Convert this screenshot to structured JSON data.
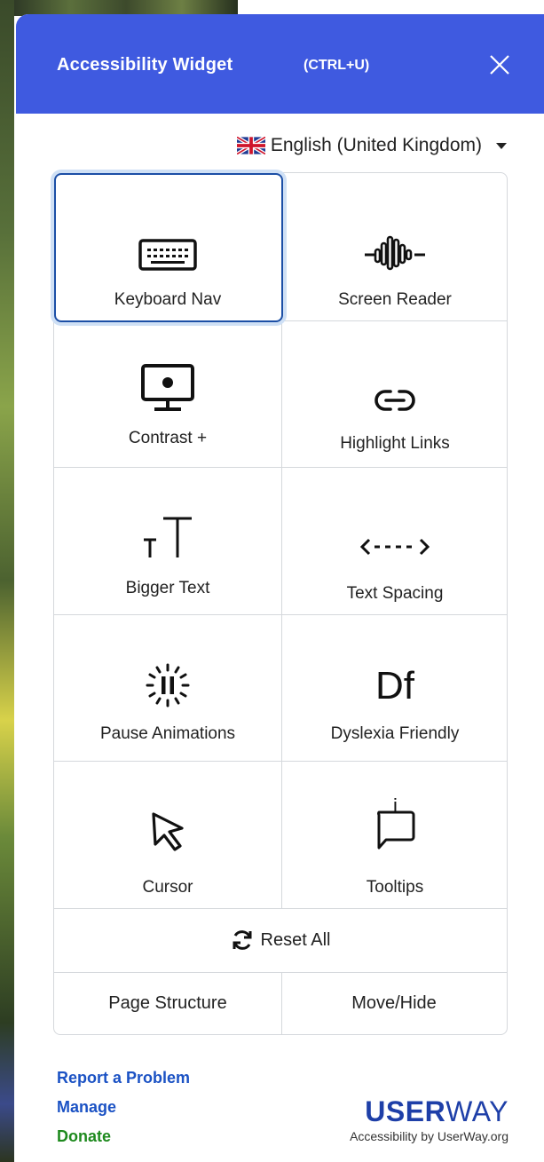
{
  "header": {
    "title": "Accessibility Widget",
    "shortcut": "(CTRL+U)",
    "close_icon": "close-icon"
  },
  "language": {
    "flag_icon": "uk-flag-icon",
    "selected": "English (United Kingdom)"
  },
  "tools": [
    {
      "label": "Keyboard Nav",
      "icon": "keyboard-icon"
    },
    {
      "label": "Screen Reader",
      "icon": "soundwave-icon"
    },
    {
      "label": "Contrast +",
      "icon": "monitor-contrast-icon"
    },
    {
      "label": "Highlight Links",
      "icon": "link-icon"
    },
    {
      "label": "Bigger Text",
      "icon": "text-size-icon"
    },
    {
      "label": "Text Spacing",
      "icon": "text-spacing-icon"
    },
    {
      "label": "Pause Animations",
      "icon": "pause-animation-icon"
    },
    {
      "label": "Dyslexia Friendly",
      "icon": "dyslexia-font-icon",
      "glyph": "Df"
    },
    {
      "label": "Cursor",
      "icon": "cursor-icon"
    },
    {
      "label": "Tooltips",
      "icon": "tooltip-icon",
      "glyph": "i"
    }
  ],
  "reset": {
    "label": "Reset All",
    "icon": "refresh-icon"
  },
  "bottom": {
    "page_structure": "Page Structure",
    "move_hide": "Move/Hide"
  },
  "footer": {
    "report": "Report a Problem",
    "manage": "Manage",
    "donate": "Donate",
    "brand_bold": "USER",
    "brand_light": "WAY",
    "brand_sub": "Accessibility by UserWay.org"
  },
  "colors": {
    "header_bg": "#3f5ae0",
    "link_blue": "#1b52c4",
    "link_green": "#1e8a1e",
    "brand_blue": "#1e3fa8",
    "focus_border": "#1c4fa6"
  }
}
